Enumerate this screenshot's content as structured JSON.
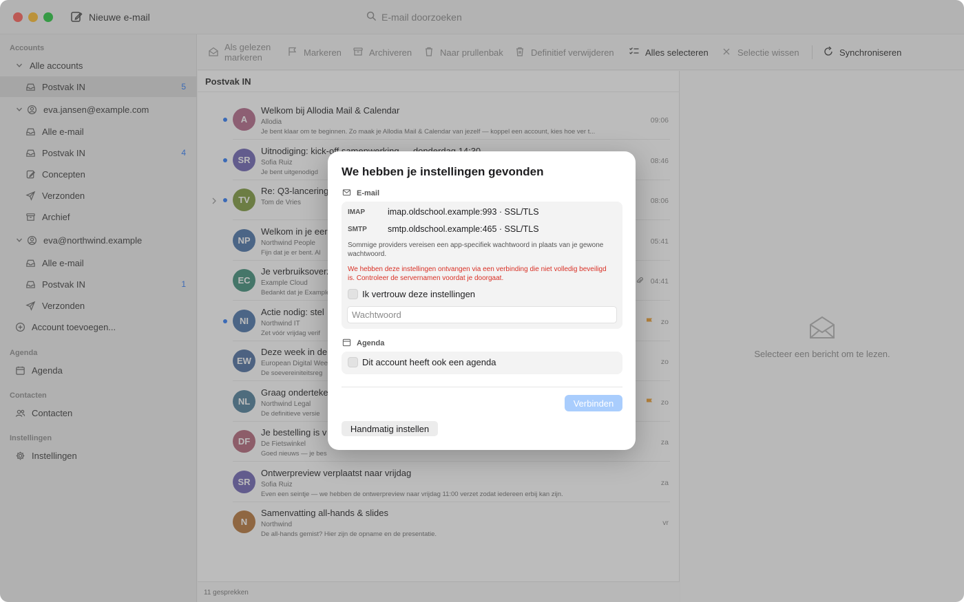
{
  "titlebar": {
    "new_mail_label": "Nieuwe e-mail",
    "search_placeholder": "E-mail doorzoeken"
  },
  "sidebar": {
    "sections": {
      "accounts": "Accounts",
      "agenda": "Agenda",
      "contacten": "Contacten",
      "instellingen": "Instellingen"
    },
    "all_accounts": "Alle accounts",
    "inbox_all": {
      "label": "Postvak IN",
      "count": "5"
    },
    "account1": {
      "email": "eva.jansen@example.com",
      "items": [
        {
          "label": "Alle e-mail",
          "count": ""
        },
        {
          "label": "Postvak IN",
          "count": "4"
        },
        {
          "label": "Concepten",
          "count": ""
        },
        {
          "label": "Verzonden",
          "count": ""
        },
        {
          "label": "Archief",
          "count": ""
        }
      ]
    },
    "account2": {
      "email": "eva@northwind.example",
      "items": [
        {
          "label": "Alle e-mail",
          "count": ""
        },
        {
          "label": "Postvak IN",
          "count": "1"
        },
        {
          "label": "Verzonden",
          "count": ""
        }
      ]
    },
    "add_account": "Account toevoegen...",
    "agenda_item": "Agenda",
    "contacten_item": "Contacten",
    "instellingen_item": "Instellingen"
  },
  "toolbar": {
    "mark_read": "Als gelezen markeren",
    "mark_read_line1": "Als gelezen",
    "mark_read_line2": "markeren",
    "markeren": "Markeren",
    "archive": "Archiveren",
    "trash": "Naar prullenbak",
    "delete": "Definitief verwijderen",
    "select_all": "Alles selecteren",
    "clear_selection": "Selectie wissen",
    "sync": "Synchroniseren"
  },
  "list": {
    "title": "Postvak IN",
    "footer": "11 gesprekken",
    "rows": [
      {
        "initials": "A",
        "color": "#b36a8a",
        "subject": "Welkom bij Allodia Mail & Calendar",
        "sender": "Allodia",
        "preview": "Je bent klaar om te beginnen. Zo maak je Allodia Mail & Calendar van jezelf — koppel een account, kies hoe ver t...",
        "time": "09:06",
        "unread": true
      },
      {
        "initials": "SR",
        "color": "#6e64b4",
        "subject": "Uitnodiging: kick-off samenwerking — donderdag 14:30",
        "sender": "Sofia Ruiz",
        "preview": "Je bent uitgenodigd",
        "time": "08:46",
        "unread": true
      },
      {
        "initials": "TV",
        "color": "#7f9a3e",
        "subject": "Re: Q3-lancering",
        "sender": "Tom de Vries",
        "preview": "",
        "time": "08:06",
        "unread": true
      },
      {
        "initials": "NP",
        "color": "#4a73a8",
        "subject": "Welkom in je eerste",
        "sender": "Northwind People",
        "preview": "Fijn dat je er bent. Al",
        "time": "05:41",
        "unread": false
      },
      {
        "initials": "EC",
        "color": "#3f8f7a",
        "subject": "Je verbruiksoverzicht",
        "sender": "Example Cloud",
        "preview": "Bedankt dat je Example",
        "time": "04:41",
        "unread": false
      },
      {
        "initials": "NI",
        "color": "#4a73a8",
        "subject": "Actie nodig: stel",
        "sender": "Northwind IT",
        "preview": "Zet vóór vrijdag verif",
        "time": "zo",
        "unread": true
      },
      {
        "initials": "EW",
        "color": "#4d6fa0",
        "subject": "Deze week in de",
        "sender": "European Digital Week",
        "preview": "De soevereiniteitsreg",
        "time": "zo",
        "unread": false
      },
      {
        "initials": "NL",
        "color": "#4e7f9a",
        "subject": "Graag ondertekenen",
        "sender": "Northwind Legal",
        "preview": "De definitieve versie",
        "time": "zo",
        "unread": false
      },
      {
        "initials": "DF",
        "color": "#b3677a",
        "subject": "Je bestelling is v",
        "sender": "De Fietswinkel",
        "preview": "Goed nieuws — je bes",
        "time": "za",
        "unread": false
      },
      {
        "initials": "SR",
        "color": "#6e64b4",
        "subject": "Ontwerpreview verplaatst naar vrijdag",
        "sender": "Sofia Ruiz",
        "preview": "Even een seintje — we hebben de ontwerpreview naar vrijdag 11:00 verzet zodat iedereen erbij kan zijn.",
        "time": "za",
        "unread": false
      },
      {
        "initials": "N",
        "color": "#b7763a",
        "subject": "Samenvatting all-hands & slides",
        "sender": "Northwind",
        "preview": "De all-hands gemist? Hier zijn de opname en de presentatie.",
        "time": "vr",
        "unread": false
      }
    ]
  },
  "reader": {
    "empty_message": "Selecteer een bericht om te lezen."
  },
  "dialog": {
    "title": "We hebben je instellingen gevonden",
    "email_section": "E-mail",
    "imap_label": "IMAP",
    "imap_value": "imap.oldschool.example:993 · SSL/TLS",
    "smtp_label": "SMTP",
    "smtp_value": "smtp.oldschool.example:465 · SSL/TLS",
    "app_password_note": "Sommige providers vereisen een app-specifiek wachtwoord in plaats van je gewone wachtwoord.",
    "insecure_warning": "We hebben deze instellingen ontvangen via een verbinding die niet volledig beveiligd is. Controleer de servernamen voordat je doorgaat.",
    "trust_checkbox": "Ik vertrouw deze instellingen",
    "password_placeholder": "Wachtwoord",
    "agenda_section": "Agenda",
    "agenda_checkbox": "Dit account heeft ook een agenda",
    "connect_button": "Verbinden",
    "manual_button": "Handmatig instellen"
  }
}
